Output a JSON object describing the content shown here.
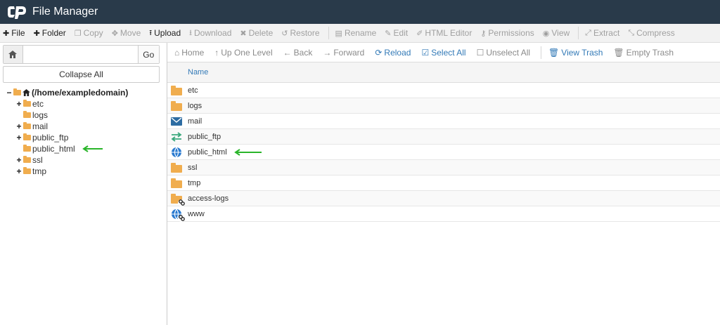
{
  "app": {
    "title": "File Manager"
  },
  "toolbar": [
    {
      "label": "File",
      "icon": "plus-icon",
      "enabled": true
    },
    {
      "label": "Folder",
      "icon": "plus-icon",
      "enabled": true
    },
    {
      "label": "Copy",
      "icon": "copy-icon",
      "enabled": false
    },
    {
      "label": "Move",
      "icon": "move-icon",
      "enabled": false
    },
    {
      "label": "Upload",
      "icon": "upload-icon",
      "enabled": true
    },
    {
      "label": "Download",
      "icon": "download-icon",
      "enabled": false
    },
    {
      "label": "Delete",
      "icon": "delete-icon",
      "enabled": false
    },
    {
      "label": "Restore",
      "icon": "restore-icon",
      "enabled": false
    },
    {
      "label": "Rename",
      "icon": "rename-icon",
      "enabled": false
    },
    {
      "label": "Edit",
      "icon": "pencil-icon",
      "enabled": false
    },
    {
      "label": "HTML Editor",
      "icon": "html-editor-icon",
      "enabled": false
    },
    {
      "label": "Permissions",
      "icon": "key-icon",
      "enabled": false
    },
    {
      "label": "View",
      "icon": "eye-icon",
      "enabled": false
    },
    {
      "label": "Extract",
      "icon": "expand-icon",
      "enabled": false
    },
    {
      "label": "Compress",
      "icon": "compress-icon",
      "enabled": false
    }
  ],
  "sidebar": {
    "search_value": "",
    "go_label": "Go",
    "collapse_label": "Collapse All",
    "root_label": "(/home/exampledomain)",
    "tree": [
      {
        "label": "etc",
        "expandable": true
      },
      {
        "label": "logs",
        "expandable": false
      },
      {
        "label": "mail",
        "expandable": true
      },
      {
        "label": "public_ftp",
        "expandable": true
      },
      {
        "label": "public_html",
        "expandable": false
      },
      {
        "label": "ssl",
        "expandable": true
      },
      {
        "label": "tmp",
        "expandable": true
      }
    ]
  },
  "nav": {
    "home": "Home",
    "up": "Up One Level",
    "back": "Back",
    "forward": "Forward",
    "reload": "Reload",
    "select_all": "Select All",
    "unselect_all": "Unselect All",
    "view_trash": "View Trash",
    "empty_trash": "Empty Trash"
  },
  "table": {
    "header_name": "Name",
    "rows": [
      {
        "name": "etc",
        "icon": "folder-icon"
      },
      {
        "name": "logs",
        "icon": "folder-icon"
      },
      {
        "name": "mail",
        "icon": "mail-icon"
      },
      {
        "name": "public_ftp",
        "icon": "transfer-icon"
      },
      {
        "name": "public_html",
        "icon": "globe-icon"
      },
      {
        "name": "ssl",
        "icon": "folder-icon"
      },
      {
        "name": "tmp",
        "icon": "folder-icon"
      },
      {
        "name": "access-logs",
        "icon": "folder-link-icon"
      },
      {
        "name": "www",
        "icon": "globe-link-icon"
      }
    ]
  },
  "colors": {
    "header_bg": "#293a4a",
    "folder": "#f0ad4e",
    "link_blue": "#337ab7",
    "annotation_arrow": "#2ab52a"
  }
}
